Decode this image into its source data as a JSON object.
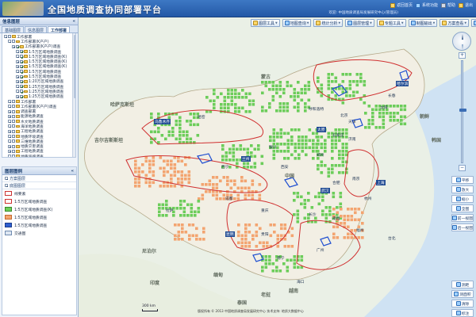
{
  "header": {
    "title": "全国地质调查协同部署平台",
    "links": [
      "返回首页",
      "系统功能",
      "帮助",
      "退出"
    ],
    "user": "欢迎: 中国地质调查局发展研究中心(管理员)"
  },
  "left": {
    "panel_title": "信息图层",
    "tabs": [
      "基础图层",
      "信息图层",
      "工作部署"
    ],
    "tree": [
      "工作部署",
      "工作部署(K产产)",
      "工作部署(K产产)调查",
      "1:5万区域地质调查",
      "1:5万区域地质调查(K)",
      "1:5万区域地质调查(K)",
      "1:5万区域地质调查(K)",
      "1:5万区域地质调查",
      "1:5万区域地质调查",
      "1:20万区域地质调查",
      "1:25万区域地质调查",
      "1:25万区域地质调查",
      "1:25万区域地质调查",
      "工作部署",
      "工作部署(K产产)调查",
      "调查部署",
      "能源地质调查",
      "水文地质调查",
      "海洋地质调查",
      "工程地质调查",
      "地质环境调查",
      "三维地质调查",
      "地质灾害调查",
      "工程地质调查",
      "地质遥感调查",
      "地质资料服务"
    ],
    "legend_title": "图层图例",
    "legend_sub": "方案图层",
    "legend_group": "底图图层",
    "legend_items": [
      {
        "label": "线要素",
        "color": "#ffffff",
        "border": "#cc3333"
      },
      {
        "label": "1:5万区域地质调查",
        "color": "#ffffff",
        "border": "#d03030"
      },
      {
        "label": "1:5万区域地质调查(K)",
        "color": "#6ccd5a",
        "border": "#3b8a2c"
      },
      {
        "label": "1:5万区域地质调查",
        "color": "#f3a470",
        "border": "#c46b30"
      },
      {
        "label": "1:5万区域地质调查",
        "color": "#2f5fd0",
        "border": "#1a3b8a"
      },
      {
        "label": "交通图",
        "color": "#dde6f2",
        "border": "#6f8bb0"
      }
    ]
  },
  "toolbar": {
    "buttons": [
      "图层工具",
      "地图查询",
      "统计分析",
      "图层管理",
      "专题工具",
      "制图输出",
      "方案查看",
      "个人设置"
    ]
  },
  "right_tools": [
    "平移",
    "放大",
    "缩小",
    "全图",
    "前一视图",
    "后一视图",
    "测距",
    "测面积",
    "清除",
    "标注",
    "图层设置"
  ],
  "map_labels": {
    "countries": [
      "蒙古",
      "哈萨克斯坦",
      "吉尔吉斯斯坦",
      "印度",
      "缅甸",
      "老挝",
      "越南",
      "泰国",
      "尼泊尔",
      "朝鲜",
      "韩国"
    ],
    "cities": [
      "乌鲁木齐",
      "哈密",
      "呼和浩特",
      "北京",
      "天津",
      "太原",
      "石家庄",
      "济南",
      "郑州",
      "西安",
      "兰州",
      "西宁",
      "银川",
      "成都",
      "重庆",
      "武汉",
      "长沙",
      "南昌",
      "合肥",
      "南京",
      "上海",
      "杭州",
      "福州",
      "广州",
      "南宁",
      "昆明",
      "贵阳",
      "拉萨",
      "沈阳",
      "长春",
      "哈尔滨",
      "台北",
      "海口"
    ],
    "region": "中国"
  },
  "scale_label": "300 km",
  "footer": "版权所有 © 2013 中国地质调查局发展研究中心  技术支持: 地质大数据中心",
  "colors": {
    "header": "#2e68b8",
    "green_tile": "#6ccd5a",
    "orange_tile": "#f3a470",
    "red_line": "#d03030",
    "blue_outline": "#1f4fd1"
  }
}
